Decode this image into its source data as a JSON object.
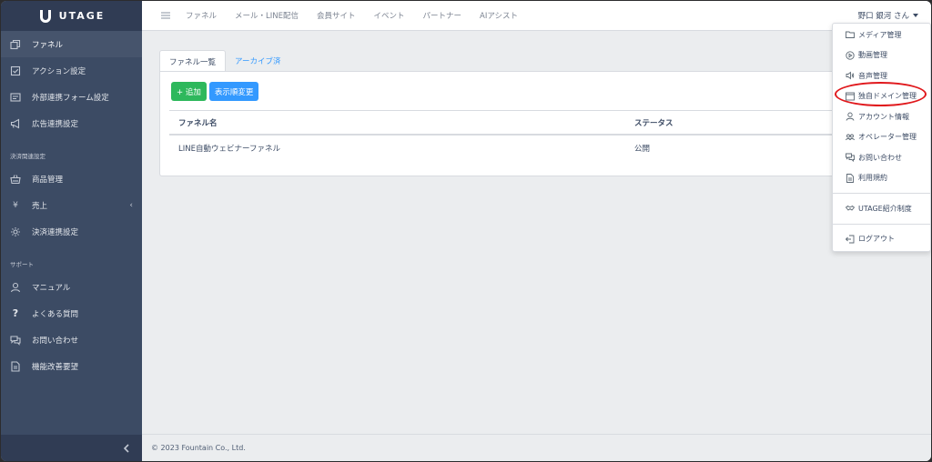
{
  "brand": {
    "name": "UTAGE"
  },
  "sidebar": {
    "items": [
      {
        "label": "ファネル",
        "icon": "copy-icon"
      },
      {
        "label": "アクション設定",
        "icon": "task-icon"
      },
      {
        "label": "外部連携フォーム設定",
        "icon": "window-icon"
      },
      {
        "label": "広告連携設定",
        "icon": "bullhorn-icon"
      }
    ],
    "section_payment": "決済関連設定",
    "payment_items": [
      {
        "label": "商品管理",
        "icon": "basket-icon"
      },
      {
        "label": "売上",
        "icon": "yen-icon",
        "chevron": "‹"
      },
      {
        "label": "決済連携設定",
        "icon": "settings-icon"
      }
    ],
    "section_support": "サポート",
    "support_items": [
      {
        "label": "マニュアル",
        "icon": "user-icon"
      },
      {
        "label": "よくある質問",
        "icon": "question-icon"
      },
      {
        "label": "お問い合わせ",
        "icon": "chat-icon"
      },
      {
        "label": "機能改善要望",
        "icon": "document-icon"
      }
    ]
  },
  "header": {
    "links": [
      "ファネル",
      "メール・LINE配信",
      "会員サイト",
      "イベント",
      "パートナー",
      "AIアシスト"
    ],
    "user": "野口 銀河 さん"
  },
  "main": {
    "tabs": [
      "ファネル一覧",
      "アーカイブ済"
    ],
    "add_button": "+ 追加",
    "order_button": "表示順変更",
    "table": {
      "headers": [
        "ファネル名",
        "ステータス"
      ],
      "rows": [
        [
          "LINE自動ウェビナーファネル",
          "公開"
        ]
      ]
    }
  },
  "footer": {
    "copyright": "© 2023 Fountain Co., Ltd."
  },
  "dropdown": {
    "items": [
      {
        "label": "メディア管理",
        "icon": "folder-icon"
      },
      {
        "label": "動画管理",
        "icon": "play-circle-icon"
      },
      {
        "label": "音声管理",
        "icon": "volume-icon"
      },
      {
        "label": "独自ドメイン管理",
        "icon": "browser-icon"
      },
      {
        "label": "アカウント情報",
        "icon": "user-icon"
      },
      {
        "label": "オペレーター管理",
        "icon": "people-icon"
      },
      {
        "label": "お問い合わせ",
        "icon": "chat-icon"
      },
      {
        "label": "利用規約",
        "icon": "document-icon"
      }
    ],
    "referral": {
      "label": "UTAGE紹介制度",
      "icon": "handshake-icon"
    },
    "logout": {
      "label": "ログアウト",
      "icon": "logout-icon"
    }
  },
  "colors": {
    "sidebar": "#3c4b64",
    "primary": "#3399ff",
    "success": "#2eb85c",
    "highlight": "#e0181c"
  }
}
